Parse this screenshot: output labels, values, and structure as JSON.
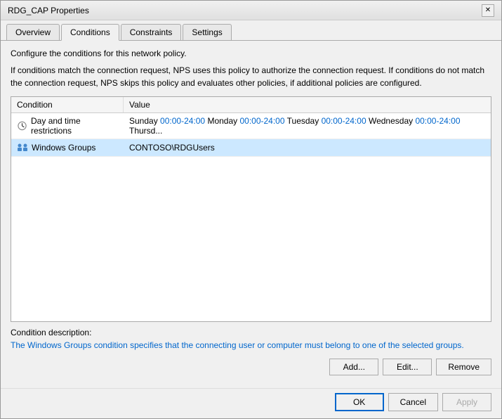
{
  "window": {
    "title": "RDG_CAP Properties",
    "close_label": "✕"
  },
  "tabs": [
    {
      "id": "overview",
      "label": "Overview"
    },
    {
      "id": "conditions",
      "label": "Conditions",
      "active": true
    },
    {
      "id": "constraints",
      "label": "Constraints"
    },
    {
      "id": "settings",
      "label": "Settings"
    }
  ],
  "description1": "Configure the conditions for this network policy.",
  "description2": "If conditions match the connection request, NPS uses this policy to authorize the connection request. If conditions do not match the connection request, NPS skips this policy and evaluates other policies, if additional policies are configured.",
  "table": {
    "columns": [
      {
        "id": "condition",
        "label": "Condition"
      },
      {
        "id": "value",
        "label": "Value"
      }
    ],
    "rows": [
      {
        "condition": "Day and time restrictions",
        "value_plain": "Sunday 00:00-24:00 Monday ",
        "value_blue": "00:00-24:00",
        "value_after_blue": " Tuesday ",
        "value_blue2": "00:00-24:00",
        "value_after_blue2": " Wednesday ",
        "value_blue3": "00:00-24:00",
        "value_after_blue3": " Thursd...",
        "icon": "clock",
        "selected": false,
        "full_value": "Sunday 00:00-24:00 Monday 00:00-24:00 Tuesday 00:00-24:00 Wednesday 00:00-24:00 Thursd..."
      },
      {
        "condition": "Windows Groups",
        "value": "CONTOSO\\RDGUsers",
        "icon": "group",
        "selected": true
      }
    ]
  },
  "condition_description": {
    "label": "Condition description:",
    "text": "The Windows Groups condition specifies that the connecting user or computer must belong to one of the selected groups."
  },
  "buttons": {
    "add": "Add...",
    "edit": "Edit...",
    "remove": "Remove"
  },
  "footer_buttons": {
    "ok": "OK",
    "cancel": "Cancel",
    "apply": "Apply"
  }
}
